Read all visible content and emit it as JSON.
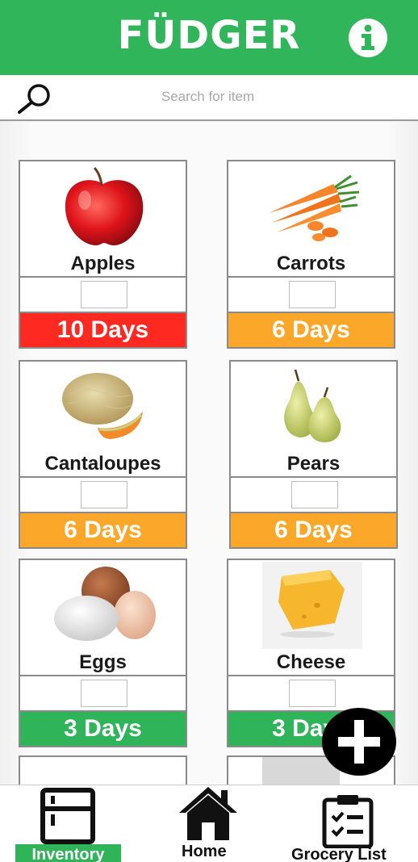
{
  "header": {
    "title": "FÜDGER",
    "info_icon": "info-icon"
  },
  "search": {
    "placeholder": "Search for item",
    "icon": "search-icon"
  },
  "colors": {
    "brand_green": "#31b55a",
    "status_red": "#fe2a21",
    "status_orange": "#fba72a",
    "status_green": "#2fb45a"
  },
  "items": [
    {
      "name": "Apples",
      "days": "10 Days",
      "status": "red"
    },
    {
      "name": "Carrots",
      "days": "6 Days",
      "status": "orange"
    },
    {
      "name": "Cantaloupes",
      "days": "6 Days",
      "status": "orange"
    },
    {
      "name": "Pears",
      "days": "6 Days",
      "status": "orange"
    },
    {
      "name": "Eggs",
      "days": "3 Days",
      "status": "green"
    },
    {
      "name": "Cheese",
      "days": "3 Days",
      "status": "green"
    }
  ],
  "fab": {
    "icon": "plus-icon"
  },
  "nav": {
    "inventory": {
      "label": "Inventory",
      "icon": "fridge-icon"
    },
    "home": {
      "label": "Home",
      "icon": "home-icon"
    },
    "grocery": {
      "label": "Grocery List",
      "icon": "clipboard-checklist-icon"
    }
  }
}
